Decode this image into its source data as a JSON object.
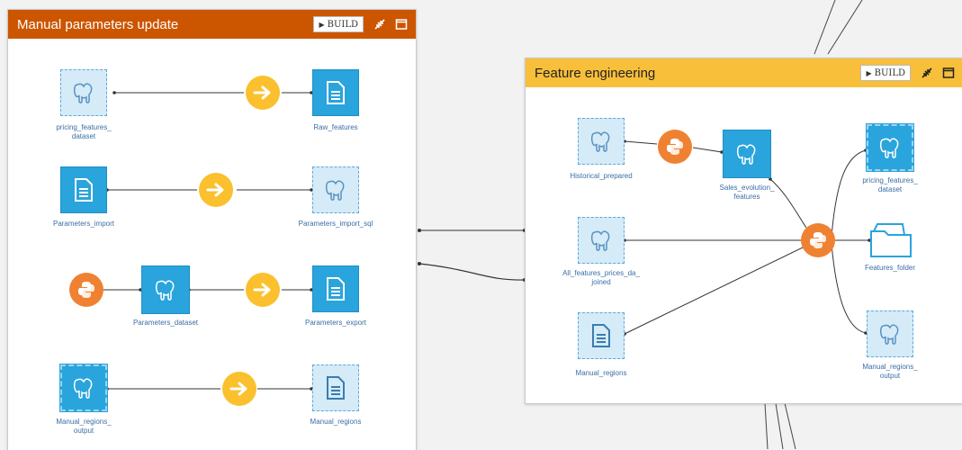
{
  "colors": {
    "zone1_header": "#cc5500",
    "zone2_header": "#f8bf3a",
    "dataset_dark": "#29a4dc",
    "dataset_light": "#d5ebf7",
    "recipe_yellow": "#fbc02d",
    "recipe_orange": "#ef8232",
    "label_blue": "#3a6ea5"
  },
  "zone1": {
    "title": "Manual parameters update",
    "build_label": "BUILD",
    "nodes": {
      "pricing_features_dataset": "pricing_features_\ndataset",
      "raw_features": "Raw_features",
      "parameters_import": "Parameters_import",
      "parameters_import_sql": "Parameters_import_sql",
      "parameters_dataset": "Parameters_dataset",
      "parameters_export": "Parameters_export",
      "manual_regions_output": "Manual_regions_\noutput",
      "manual_regions": "Manual_regions"
    }
  },
  "zone2": {
    "title": "Feature engineering",
    "build_label": "BUILD",
    "nodes": {
      "historical_prepared": "Historical_prepared",
      "sales_evolution_features": "Sales_evolution_\nfeatures",
      "all_features_prices": "All_features_prices_da_\njoined",
      "manual_regions": "Manual_regions",
      "pricing_features_dataset": "pricing_features_\ndataset",
      "features_folder": "Features_folder",
      "manual_regions_output": "Manual_regions_\noutput"
    }
  }
}
